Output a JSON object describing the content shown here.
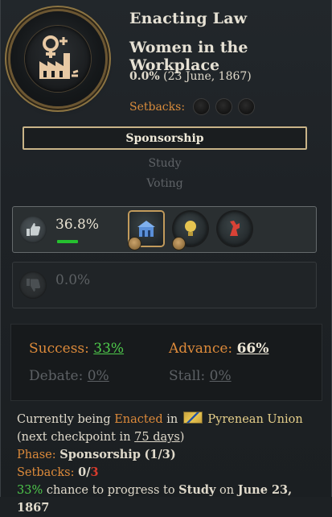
{
  "header": {
    "status_label": "Enacting Law",
    "law_name": "Women in the Workplace",
    "progress_pct": "0.0%",
    "progress_date": "(23 June, 1867)",
    "setbacks_label": "Setbacks:",
    "setback_count": 3
  },
  "phases": {
    "active": "Sponsorship",
    "next": "Study",
    "last": "Voting"
  },
  "support": {
    "for_pct": "36.8%",
    "against_pct": "0.0%",
    "interest_groups": [
      "intelligentsia-icon",
      "industrialists-icon",
      "trade-unions-icon"
    ]
  },
  "stats": {
    "success_label": "Success:",
    "success_value": "33%",
    "advance_label": "Advance:",
    "advance_value": "66%",
    "debate_label": "Debate:",
    "debate_value": "0%",
    "stall_label": "Stall:",
    "stall_value": "0%"
  },
  "description": {
    "p1_a": "Currently being ",
    "p1_enacted": "Enacted",
    "p1_b": " in ",
    "country": "Pyrenean Union",
    "p1_c": " (next checkpoint in ",
    "checkpoint": "75 days",
    "p1_d": ")",
    "phase_label": "Phase:",
    "phase_value": "Sponsorship",
    "phase_count": "(1/3)",
    "setbacks_label": "Setbacks:",
    "setbacks_current": "0",
    "setbacks_sep": "/",
    "setbacks_max": "3",
    "chance_pct": "33%",
    "chance_text": " chance to progress to ",
    "chance_phase": "Study",
    "chance_on": " on ",
    "chance_date": "June 23, 1867"
  },
  "colors": {
    "accent_orange": "#dd8a3a",
    "positive_green": "#4ec94b",
    "negative_red": "#d83b2c",
    "gold_frame": "#c9b488"
  }
}
